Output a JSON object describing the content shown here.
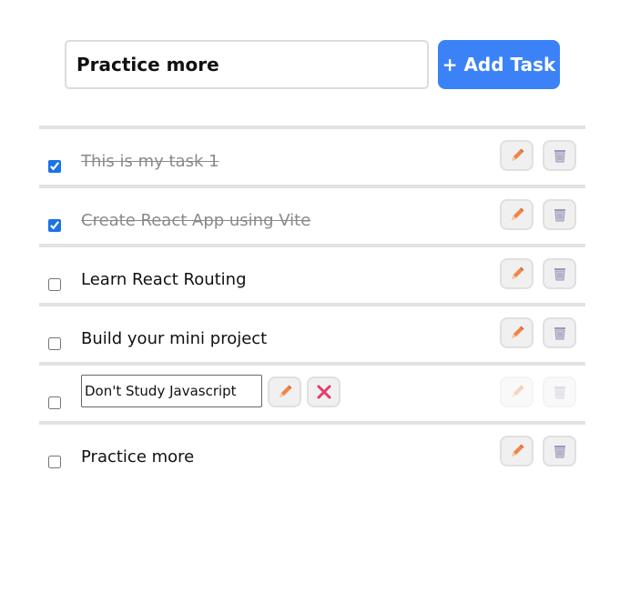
{
  "input": {
    "value": "Practice more"
  },
  "add_button": {
    "label": "+ Add Task"
  },
  "colors": {
    "accent": "#3b82f6",
    "checkbox": "#1a73e8",
    "pencil": "#f0844a",
    "cancel": "#e63b6a",
    "trash": "#9a9ab8"
  },
  "icons": {
    "edit": "pencil-icon",
    "delete": "trash-icon",
    "cancel": "close-icon"
  },
  "tasks": [
    {
      "label": "This is my task 1",
      "completed": true
    },
    {
      "label": "Create React App using Vite",
      "completed": true
    },
    {
      "label": "Learn React Routing",
      "completed": false
    },
    {
      "label": "Build your mini project",
      "completed": false
    },
    {
      "label": "Don't Study Javascript",
      "completed": false,
      "editing": true
    },
    {
      "label": "Practice more",
      "completed": false
    }
  ]
}
